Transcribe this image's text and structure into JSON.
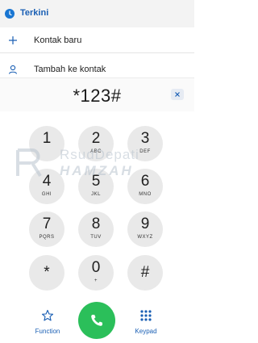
{
  "header": {
    "title": "Terkini"
  },
  "actions": [
    {
      "label": "Kontak baru",
      "icon": "plus-icon"
    },
    {
      "label": "Tambah ke kontak",
      "icon": "person-icon"
    }
  ],
  "display": {
    "number": "*123#"
  },
  "watermark": {
    "top": "RsudDepati",
    "bottom": "HAMZAH"
  },
  "keypad": [
    {
      "digit": "1",
      "letters": ""
    },
    {
      "digit": "2",
      "letters": "ABC"
    },
    {
      "digit": "3",
      "letters": "DEF"
    },
    {
      "digit": "4",
      "letters": "GHI"
    },
    {
      "digit": "5",
      "letters": "JKL"
    },
    {
      "digit": "6",
      "letters": "MNO"
    },
    {
      "digit": "7",
      "letters": "PQRS"
    },
    {
      "digit": "8",
      "letters": "TUV"
    },
    {
      "digit": "9",
      "letters": "WXYZ"
    },
    {
      "digit": "*",
      "letters": ""
    },
    {
      "digit": "0",
      "letters": "+"
    },
    {
      "digit": "#",
      "letters": ""
    }
  ],
  "bottom_bar": {
    "function_label": "Function",
    "keypad_label": "Keypad"
  },
  "colors": {
    "accent": "#1a5fb4",
    "call": "#2bbf5a",
    "key_bg": "#e9e9e9"
  }
}
